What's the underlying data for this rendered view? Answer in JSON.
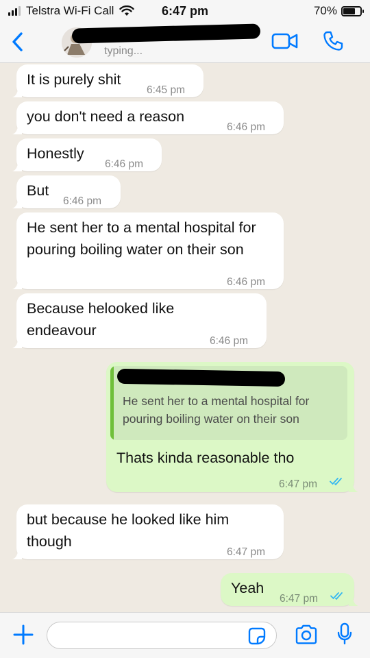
{
  "status_bar": {
    "carrier": "Telstra Wi-Fi Call",
    "time": "6:47 pm",
    "battery": "70%",
    "battery_level": 0.7,
    "icons": [
      "signal-icon",
      "wifi-icon",
      "battery-icon"
    ]
  },
  "header": {
    "status": "typing...",
    "icons": [
      "back-chevron-icon",
      "avatar",
      "video-call-icon",
      "phone-call-icon"
    ]
  },
  "messages": [
    {
      "direction": "incoming",
      "text": "It is purely shit",
      "time": "6:45 pm"
    },
    {
      "direction": "incoming",
      "text": "you don't need a reason",
      "time": "6:46 pm"
    },
    {
      "direction": "incoming",
      "text": "Honestly",
      "time": "6:46 pm"
    },
    {
      "direction": "incoming",
      "text": "But",
      "time": "6:46 pm"
    },
    {
      "direction": "incoming",
      "text": "He sent her to a mental hospital for pouring boiling water on their son",
      "time": "6:46 pm"
    },
    {
      "direction": "incoming",
      "text": "Because helooked like endeavour",
      "time": "6:46 pm"
    },
    {
      "direction": "outgoing",
      "quote": "He sent her to a mental hospital for pouring boiling water on their son",
      "text": "Thats kinda reasonable tho",
      "time": "6:47 pm",
      "status": "read"
    },
    {
      "direction": "incoming",
      "text": "but because he looked like him though",
      "time": "6:47 pm"
    },
    {
      "direction": "outgoing",
      "text": "Yeah",
      "time": "6:47 pm",
      "status": "read"
    }
  ],
  "composer": {
    "value": "",
    "icons": [
      "plus-icon",
      "sticker-icon",
      "camera-icon",
      "microphone-icon"
    ]
  },
  "colors": {
    "chat_background": "#efeae2",
    "incoming_bubble": "#ffffff",
    "outgoing_bubble": "#dcf8c6",
    "accent_blue": "#007aff",
    "read_tick": "#34b7f1"
  }
}
